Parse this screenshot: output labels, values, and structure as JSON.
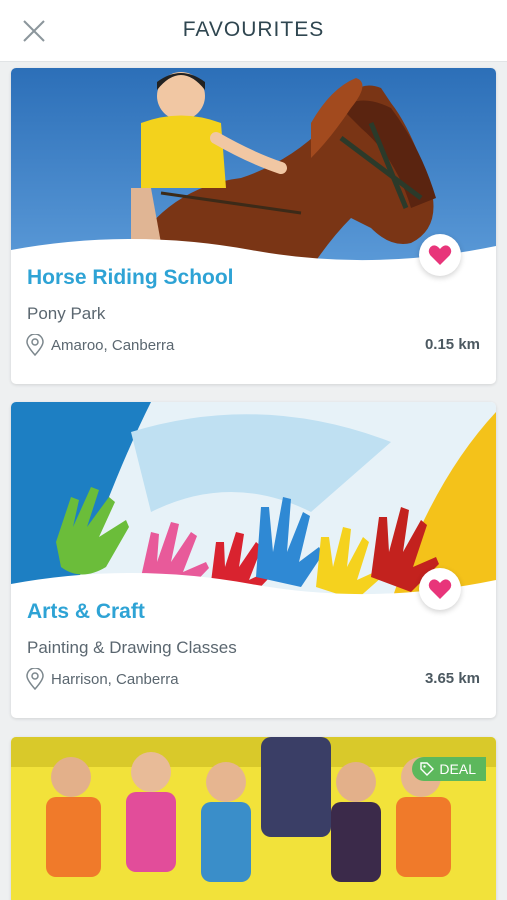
{
  "header": {
    "title": "FAVOURITES",
    "close_icon": "close-icon"
  },
  "colors": {
    "title_blue": "#2ea3d5",
    "heart_pink": "#e8357a",
    "deal_green": "#5cb85c",
    "text_grey": "#5b6770"
  },
  "favourites": [
    {
      "title": "Horse Riding School",
      "subtitle": "Pony Park",
      "location": "Amaroo, Canberra",
      "distance": "0.15 km",
      "favourited": true
    },
    {
      "title": "Arts & Craft",
      "subtitle": "Painting & Drawing Classes",
      "location": "Harrison, Canberra",
      "distance": "3.65 km",
      "favourited": true
    },
    {
      "badge": "DEAL"
    }
  ]
}
